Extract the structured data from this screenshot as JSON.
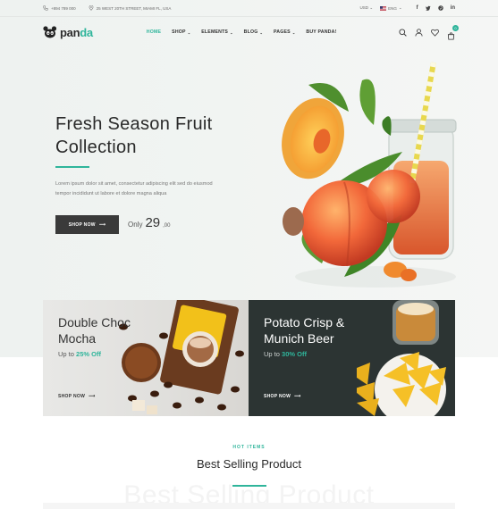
{
  "topbar": {
    "phone": "+894 789 000",
    "address": "25 WEST 20TH STREET, MIAMI FL, USA",
    "currency": "USD",
    "language": "ENG"
  },
  "header": {
    "logo_text": "panda",
    "logo_tagline": "",
    "nav": [
      {
        "label": "HOME",
        "active": true,
        "dropdown": false
      },
      {
        "label": "SHOP",
        "active": false,
        "dropdown": true
      },
      {
        "label": "ELEMENTS",
        "active": false,
        "dropdown": true
      },
      {
        "label": "BLOG",
        "active": false,
        "dropdown": true
      },
      {
        "label": "PAGES",
        "active": false,
        "dropdown": true
      },
      {
        "label": "BUY PANDA!",
        "active": false,
        "dropdown": false
      }
    ],
    "cart_count": "0",
    "icons": [
      "search-icon",
      "user-icon",
      "heart-icon",
      "cart-icon"
    ]
  },
  "hero": {
    "title_line1": "Fresh Season Fruit",
    "title_line2": "Collection",
    "desc_line1": "Lorem ipsum dolor sit amet, consectetur adipiscing elit sed do eiusmod",
    "desc_line2": "tempor incididunt ut labore et dolore magna aliqua",
    "button": "SHOP NOW",
    "price_prefix": "Only",
    "price_main": "29",
    "price_cents": ",00"
  },
  "banners": [
    {
      "title_line1": "Double Choc",
      "title_line2": "Mocha",
      "sub_prefix": "Up to",
      "percent": "25% Off",
      "link": "SHOP NOW"
    },
    {
      "title_line1": "Potato Crisp &",
      "title_line2": "Munich Beer",
      "sub_prefix": "Up to",
      "percent": "30% Off",
      "link": "SHOP NOW"
    }
  ],
  "section": {
    "eyebrow": "HOT ITEMS",
    "title": "Best Selling Product",
    "ghost": "Best Selling Product"
  },
  "colors": {
    "accent": "#2fb59b",
    "dark": "#3a3a3a",
    "banner_dark": "#2c3433"
  }
}
